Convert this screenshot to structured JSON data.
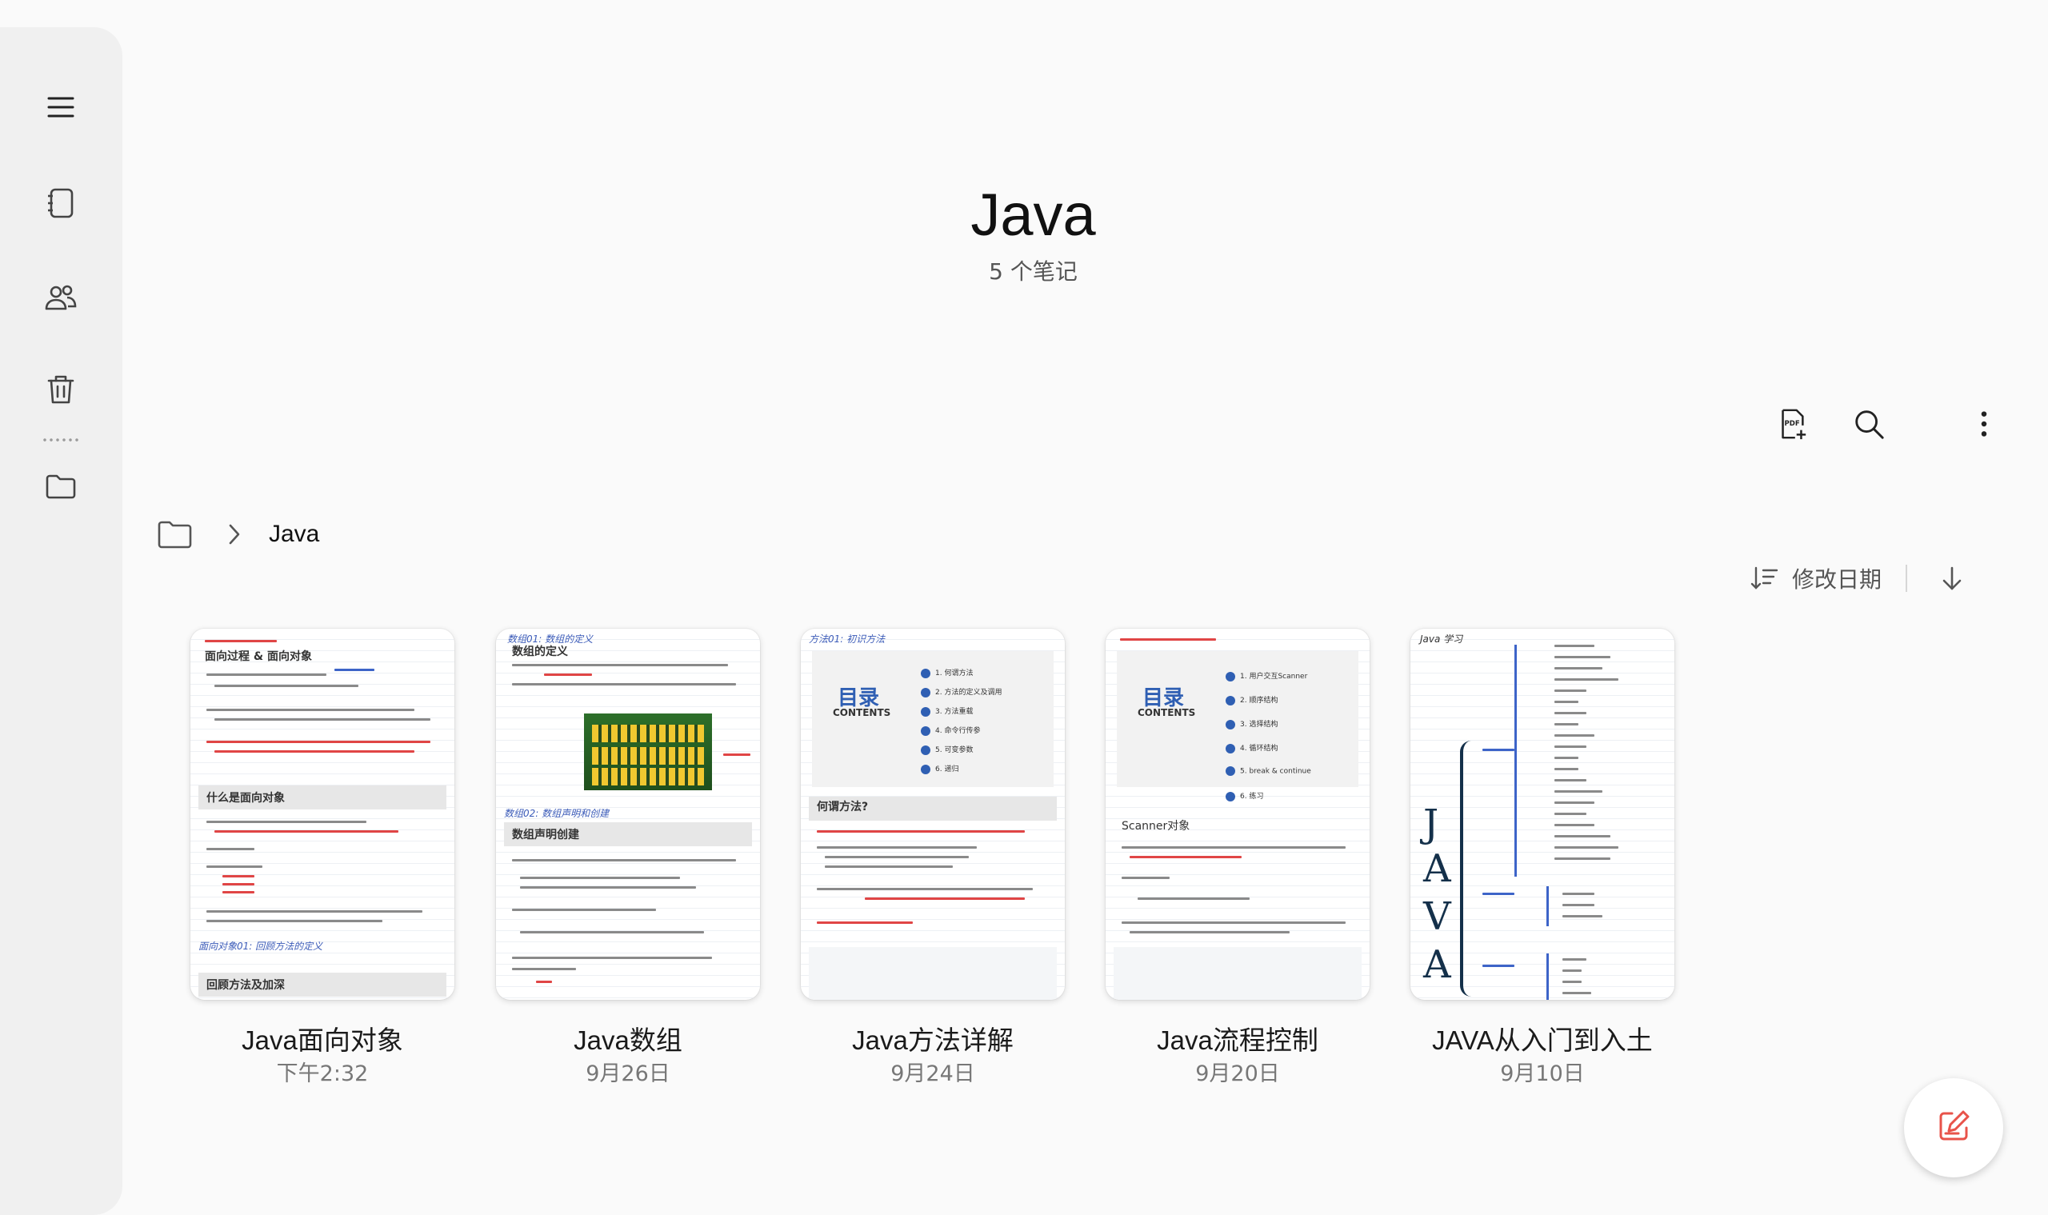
{
  "sidebar": {
    "items": [
      {
        "name": "menu-icon"
      },
      {
        "name": "notebook-icon"
      },
      {
        "name": "shared-icon"
      },
      {
        "name": "trash-icon"
      },
      {
        "name": "folder-icon"
      }
    ]
  },
  "header": {
    "title": "Java",
    "subtitle": "5 个笔记"
  },
  "toolbar": {
    "icons": [
      "pdf-add-icon",
      "search-icon",
      "more-vert-icon"
    ]
  },
  "breadcrumb": {
    "current": "Java"
  },
  "sort": {
    "label": "修改日期"
  },
  "notes": [
    {
      "title": "Java面向对象",
      "date": "下午2:32"
    },
    {
      "title": "Java数组",
      "date": "9月26日"
    },
    {
      "title": "Java方法详解",
      "date": "9月24日"
    },
    {
      "title": "Java流程控制",
      "date": "9月20日"
    },
    {
      "title": "JAVA从入门到入土",
      "date": "9月10日"
    }
  ],
  "colors": {
    "accent": "#e8534a",
    "background": "#fafafa",
    "sidebar": "#f0f0f0"
  }
}
